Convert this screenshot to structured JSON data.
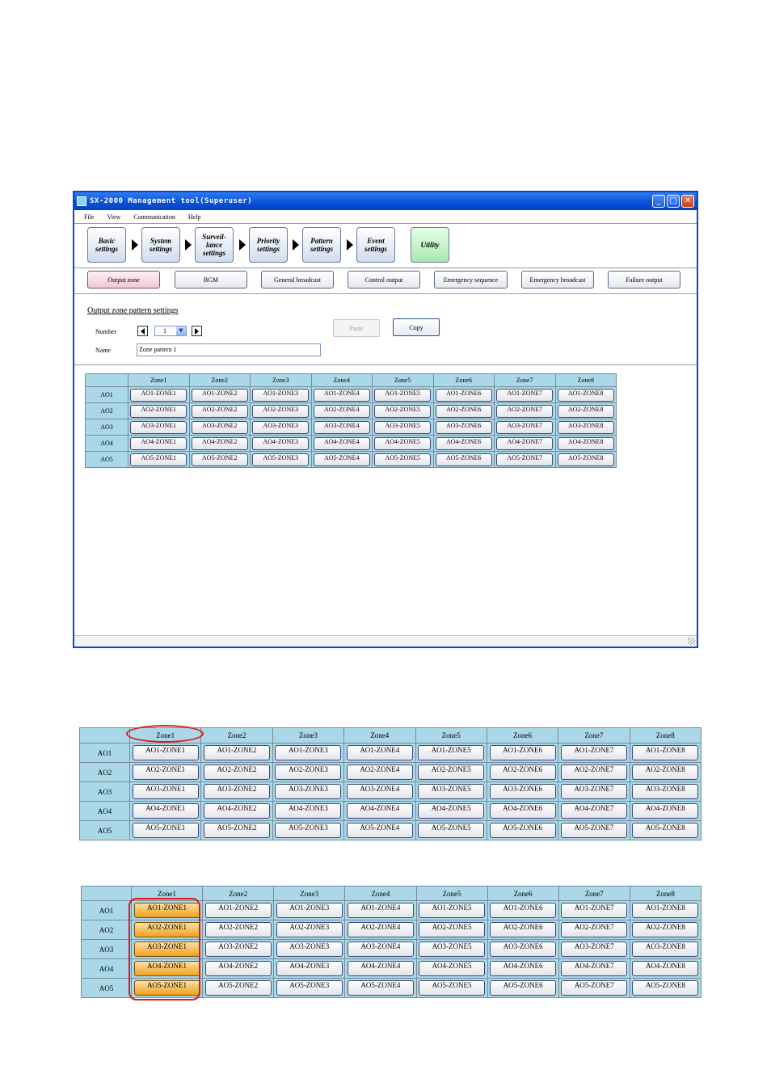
{
  "window": {
    "title": "SX-2000 Management tool(Superuser)",
    "controls": {
      "minimize": "_",
      "maximize": "□",
      "close": "✕"
    }
  },
  "menu": [
    "File",
    "View",
    "Communication",
    "Help"
  ],
  "steps": [
    {
      "line1": "Basic",
      "line2": "settings",
      "line3": ""
    },
    {
      "line1": "System",
      "line2": "settings",
      "line3": ""
    },
    {
      "line1": "Surveil-",
      "line2": "lance",
      "line3": "settings"
    },
    {
      "line1": "Priority",
      "line2": "settings",
      "line3": ""
    },
    {
      "line1": "Pattern",
      "line2": "settings",
      "line3": ""
    },
    {
      "line1": "Event",
      "line2": "settings",
      "line3": ""
    },
    {
      "line1": "Utility",
      "line2": "",
      "line3": ""
    }
  ],
  "tabs": [
    "Output zone",
    "BGM",
    "General broadcast",
    "Control output",
    "Emergency sequence",
    "Emergency broadcast",
    "Failure output"
  ],
  "form": {
    "section_title": "Output zone pattern settings",
    "number_label": "Number",
    "number_value": "1",
    "name_label": "Name",
    "name_value": "Zone pattern 1",
    "paste_label": "Paste",
    "copy_label": "Copy"
  },
  "table": {
    "columns": [
      "Zone1",
      "Zone2",
      "Zone3",
      "Zone4",
      "Zone5",
      "Zone6",
      "Zone7",
      "Zone8"
    ],
    "rows": [
      {
        "label": "AO1",
        "cells": [
          "AO1-ZONE1",
          "AO1-ZONE2",
          "AO1-ZONE3",
          "AO1-ZONE4",
          "AO1-ZONE5",
          "AO1-ZONE6",
          "AO1-ZONE7",
          "AO1-ZONE8"
        ]
      },
      {
        "label": "AO2",
        "cells": [
          "AO2-ZONE1",
          "AO2-ZONE2",
          "AO2-ZONE3",
          "AO2-ZONE4",
          "AO2-ZONE5",
          "AO2-ZONE6",
          "AO2-ZONE7",
          "AO2-ZONE8"
        ]
      },
      {
        "label": "AO3",
        "cells": [
          "AO3-ZONE1",
          "AO3-ZONE2",
          "AO3-ZONE3",
          "AO3-ZONE4",
          "AO3-ZONE5",
          "AO3-ZONE6",
          "AO3-ZONE7",
          "AO3-ZONE8"
        ]
      },
      {
        "label": "AO4",
        "cells": [
          "AO4-ZONE1",
          "AO4-ZONE2",
          "AO4-ZONE3",
          "AO4-ZONE4",
          "AO4-ZONE5",
          "AO4-ZONE6",
          "AO4-ZONE7",
          "AO4-ZONE8"
        ]
      },
      {
        "label": "AO5",
        "cells": [
          "AO5-ZONE1",
          "AO5-ZONE2",
          "AO5-ZONE3",
          "AO5-ZONE4",
          "AO5-ZONE5",
          "AO5-ZONE6",
          "AO5-ZONE7",
          "AO5-ZONE8"
        ]
      }
    ]
  },
  "colors": {
    "header_bg": "#aad8e8",
    "selected_cell": "#f0a020",
    "highlight": "#e01818",
    "titlebar": "#0a52d8"
  }
}
